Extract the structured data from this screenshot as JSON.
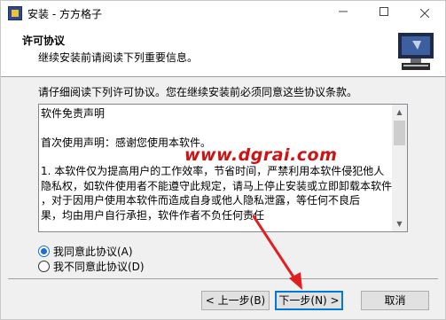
{
  "window": {
    "title": "安装 - 方方格子",
    "min_icon": "minimize-icon",
    "max_icon": "maximize-icon",
    "close_icon": "close-icon"
  },
  "header": {
    "title": "许可协议",
    "subtitle": "继续安装前请阅读下列重要信息。"
  },
  "intro": "请仔细阅读下列许可协议。您在继续安装前必须同意这些协议条款。",
  "license": {
    "lines": [
      "软件免责声明",
      "",
      "首次使用声明：感谢您使用本软件。",
      "",
      "1. 本软件仅为提高用户的工作效率，节省时间，严禁利用本软件侵犯他人",
      "隐私权，如软件使用者不能遵守此规定，请马上停止安装或立即卸载本软件",
      "，对于因用户使用本软件而造成自身或他人隐私泄露，等任何不良后",
      "果，均由用户自行承担，软件作者不负任何责任"
    ]
  },
  "options": {
    "accept": "我同意此协议(A)",
    "decline": "我不同意此协议(D)",
    "selected": "accept"
  },
  "buttons": {
    "back": "< 上一步(B)",
    "next": "下一步(N) >",
    "cancel": "取消"
  },
  "watermark": "www.dgrai.com",
  "colors": {
    "accent": "#0078d7",
    "watermark": "#d11212",
    "arrow": "#e02020"
  }
}
